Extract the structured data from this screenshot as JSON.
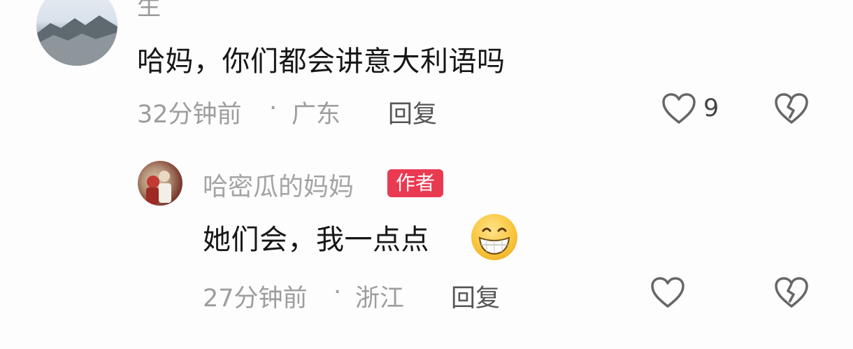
{
  "comment": {
    "username_partial": "生",
    "text": "哈妈，你们都会讲意大利语吗",
    "time": "32分钟前",
    "separator": "·",
    "location": "广东",
    "reply_label": "回复",
    "like_count": "9"
  },
  "reply": {
    "username": "哈密瓜的妈妈",
    "badge": "作者",
    "text": "她们会，我一点点",
    "emoji": "grinning-face-emoji",
    "time": "27分钟前",
    "separator": "·",
    "location": "浙江",
    "reply_label": "回复"
  },
  "icons": {
    "like": "heart-outline-icon",
    "dislike": "broken-heart-icon"
  }
}
